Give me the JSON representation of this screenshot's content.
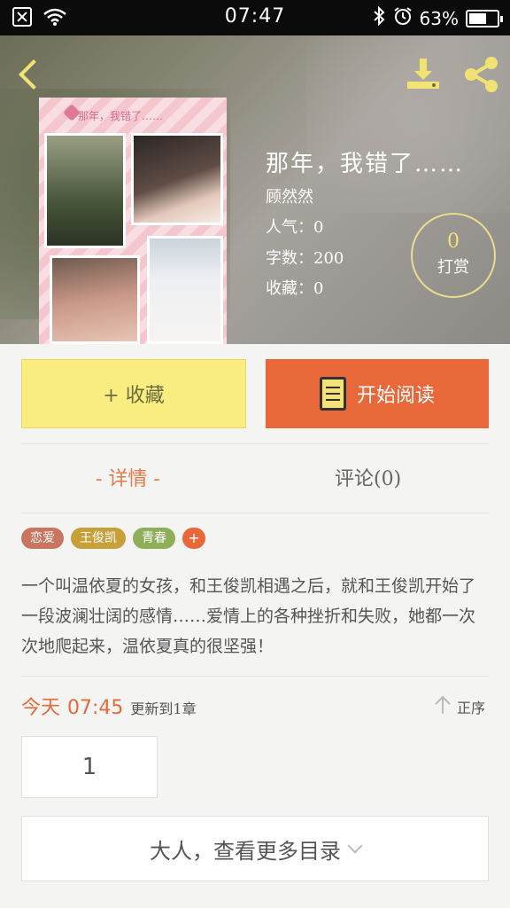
{
  "status_bar": {
    "time": "07:47",
    "battery": "63%",
    "battery_level": 0.63,
    "icons": [
      "sim-off-icon",
      "wifi-icon",
      "bluetooth-icon",
      "alarm-icon",
      "battery-icon"
    ]
  },
  "header": {
    "icons": [
      "back-icon",
      "download-icon",
      "share-icon"
    ],
    "accent_color": "#f2e274"
  },
  "book": {
    "title": "那年，我错了……",
    "author": "顾然然",
    "popularity": "人气：0",
    "word_count": "字数：200",
    "favorites": "收藏：0",
    "tip_count": "0",
    "tip_label": "打赏",
    "cover_caption": "那年，我错了……"
  },
  "actions": {
    "favorite_label": "+ 收藏",
    "read_label": "开始阅读",
    "favorite_color": "#f9ee7f",
    "read_color": "#e8683a"
  },
  "tabs": [
    {
      "label": "- 详情 -",
      "active": true
    },
    {
      "label": "评论(0)",
      "active": false
    }
  ],
  "tags": [
    {
      "label": "恋爱",
      "color": "#c9755f"
    },
    {
      "label": "王俊凯",
      "color": "#c8a03a"
    },
    {
      "label": "青春",
      "color": "#8fae5a"
    }
  ],
  "tag_add_label": "+",
  "description": "一个叫温依夏的女孩，和王俊凯相遇之后，就和王俊凯开始了一段波澜壮阔的感情……爱情上的各种挫折和失败，她都一次次地爬起来，温依夏真的很坚强！",
  "update": {
    "day": "今天",
    "time": "07:45",
    "text": "更新到1章",
    "sort_label": "正序"
  },
  "chapter_range": "1",
  "more_catalog_label": "大人，查看更多目录"
}
